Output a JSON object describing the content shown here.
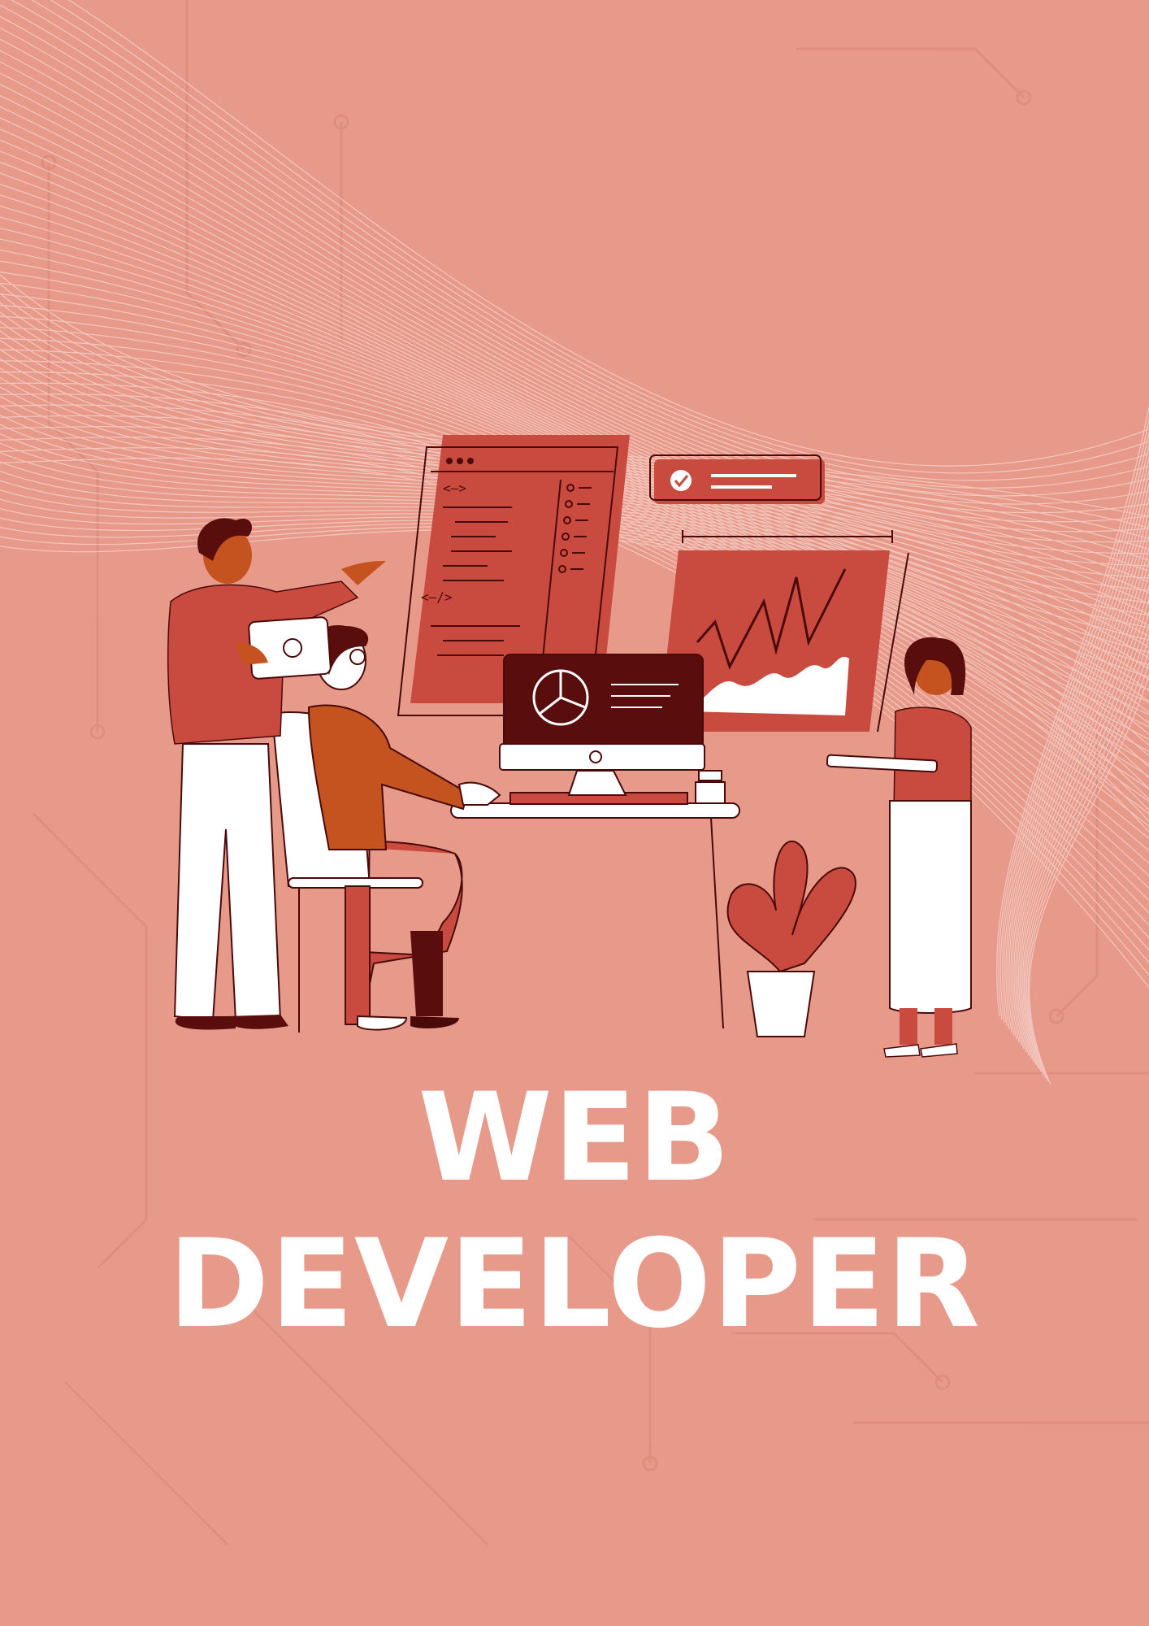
{
  "title": {
    "line1": "WEB",
    "line2": "DEVELOPER"
  },
  "colors": {
    "background": "#e89a8a",
    "primary_red": "#c94b40",
    "dark_maroon": "#5a0d0d",
    "orange": "#c4531f",
    "white": "#ffffff",
    "outline": "#4a0a0a"
  },
  "illustration": {
    "code_panel": {
      "tags": [
        "<—>",
        "<—/>"
      ]
    }
  }
}
